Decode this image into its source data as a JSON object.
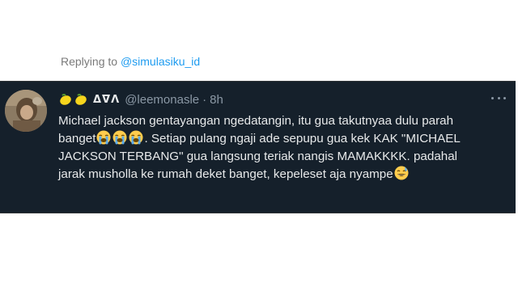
{
  "replying": {
    "prefix": "Replying to",
    "mention": "@simulasiku_id"
  },
  "tweet": {
    "display_name_emojis": [
      "lemon-emoji",
      "lemon-emoji"
    ],
    "display_name_text": "ᐃᐁᐱ",
    "handle": "@leemonasle",
    "separator": "·",
    "time": "8h",
    "body_lines": [
      [
        "Michael jackson gentayangan ngedatangin, itu gua takutnyaa dulu parah"
      ],
      [
        "banget",
        "|crying|",
        "|crying|",
        "|crying|",
        ". Setiap pulang ngaji ade sepupu gua kek KAK \"MICHAEL"
      ],
      [
        "JACKSON TERBANG\" gua langsung teriak nangis MAMAKKKK. padahal"
      ],
      [
        "jarak musholla ke rumah deket banget, kepeleset aja nyampe",
        "|sweat|"
      ]
    ],
    "body": {
      "line1": "Michael jackson gentayangan ngedatangin, itu gua takutnyaa dulu parah",
      "line2_a": "banget",
      "line2_b": ". Setiap pulang ngaji ade sepupu gua kek KAK \"MICHAEL",
      "line3": "JACKSON TERBANG\" gua langsung teriak nangis MAMAKKKK. padahal",
      "line4": "jarak musholla ke rumah deket banget, kepeleset aja nyampe"
    },
    "emojis": {
      "crying": "loudly-crying-face-emoji",
      "sweat": "grinning-face-with-sweat-emoji"
    }
  },
  "colors": {
    "background": "#15202b",
    "text": "#e7e9ea",
    "secondary": "#8b98a5",
    "accent": "#1d9bf0"
  }
}
